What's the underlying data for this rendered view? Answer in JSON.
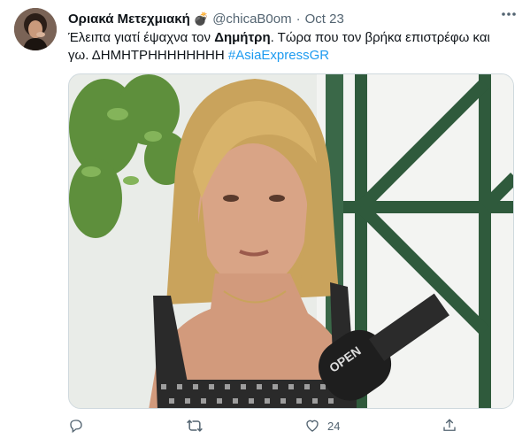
{
  "tweet": {
    "author_name": "Οριακά Μετεχμιακή",
    "author_badge": "💣",
    "handle": "@chicaB0om",
    "separator": "·",
    "date": "Oct 23",
    "text_part1": "Έλειπα γιατί έψαχνα τον ",
    "text_bold": "Δημήτρη",
    "text_part2": ". Τώρα που τον  βρήκα επιστρέφω και γω. ΔΗΜΗΤΡΗΗΗΗΗΗΗΗ ",
    "hashtag": "#AsiaExpressGR",
    "media_watermark": "OPEN",
    "actions": {
      "reply_icon": "reply-icon",
      "retweet_icon": "retweet-icon",
      "like_icon": "heart-icon",
      "like_count": "24",
      "share_icon": "share-icon"
    },
    "colors": {
      "link": "#1d9bf0",
      "muted": "#536471"
    }
  }
}
